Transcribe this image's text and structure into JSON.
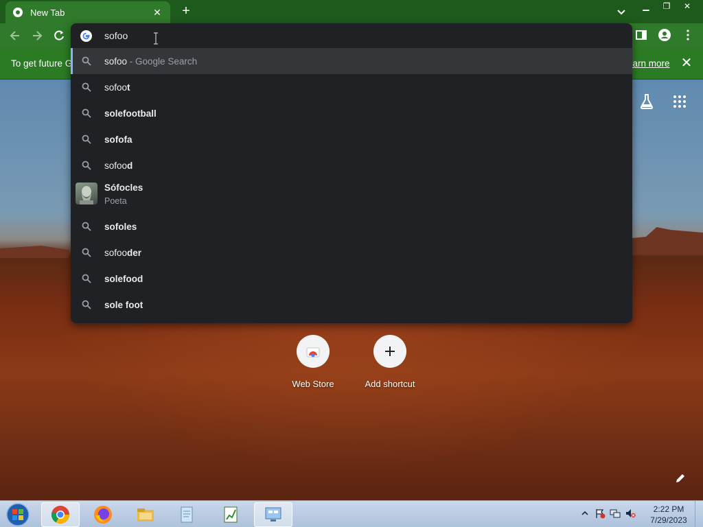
{
  "browser": {
    "tab_title": "New Tab",
    "tab_favicon": "chrome-icon",
    "window_controls": [
      "minimize-icon",
      "restore-icon",
      "close-icon"
    ]
  },
  "omnibox": {
    "value": "sofoo",
    "suggestions": [
      {
        "typed": "sofoo",
        "completion": "",
        "sep": " - ",
        "sub": "Google Search",
        "selected": true
      },
      {
        "typed": "sofoo",
        "completion": "t"
      },
      {
        "typed": "",
        "completion": "solefootball"
      },
      {
        "typed": "sofo",
        "completion": "fa"
      },
      {
        "typed": "sofoo",
        "completion": "d"
      },
      {
        "entity": true,
        "title": "Sófocles",
        "sub": "Poeta"
      },
      {
        "typed": "",
        "completion": "sofoles"
      },
      {
        "typed": "sofoo",
        "completion": "der"
      },
      {
        "typed": "",
        "completion": "solefood"
      },
      {
        "typed": "",
        "completion": "sole foot"
      }
    ]
  },
  "infobar": {
    "text": "To get future G",
    "link": "earn more"
  },
  "shortcuts": [
    {
      "label": "Web Store",
      "icon": "webstore-icon"
    },
    {
      "label": "Add shortcut",
      "icon": "plus-icon"
    }
  ],
  "taskbar": {
    "time": "2:22 PM",
    "date": "7/29/2023",
    "items": [
      "chrome-icon",
      "firefox-icon",
      "file-explorer-icon",
      "notepad-icon",
      "spreadsheet-icon",
      "control-panel-icon"
    ]
  },
  "colors": {
    "tab_strip": "#1e5a1c",
    "toolbar": "#2f7a2b",
    "dropdown": "#202124",
    "accent": "#8ab4f8"
  }
}
